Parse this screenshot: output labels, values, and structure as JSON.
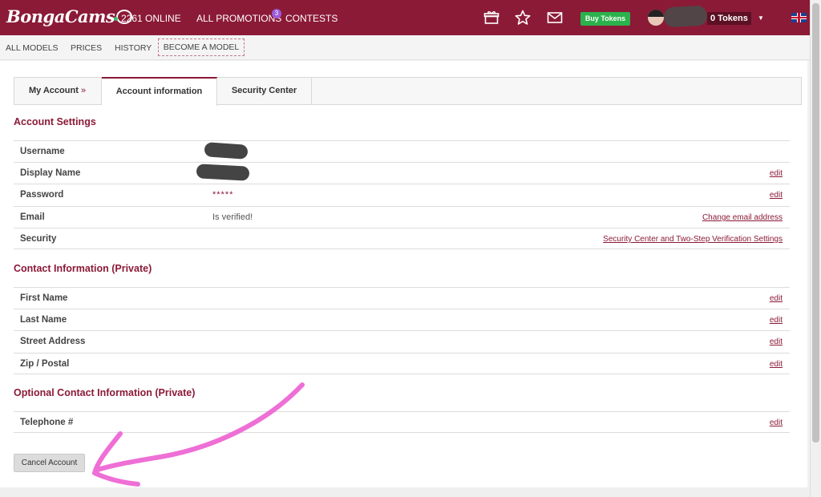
{
  "header": {
    "logo_text": "BongaCams",
    "online_text": "2261 ONLINE",
    "promotions_label": "ALL PROMOTIONS",
    "promotions_badge": "3",
    "contests_label": "CONTESTS",
    "buy_tokens_label": "Buy Tokens",
    "tokens_label": "0 Tokens",
    "icons": [
      "gift-icon",
      "star-icon",
      "mail-icon",
      "chevron-down-icon",
      "uk-flag-icon"
    ]
  },
  "subnav": {
    "items": [
      "ALL MODELS",
      "PRICES",
      "HISTORY"
    ],
    "become_model": "BECOME A MODEL"
  },
  "tabs": {
    "my_account": "My Account",
    "my_account_suffix": "»",
    "account_information": "Account information",
    "security_center": "Security Center"
  },
  "account_settings": {
    "title": "Account Settings",
    "rows": [
      {
        "label": "Username",
        "value": "",
        "action": ""
      },
      {
        "label": "Display Name",
        "value": "",
        "action": "edit"
      },
      {
        "label": "Password",
        "value": "*****",
        "action": "edit"
      },
      {
        "label": "Email",
        "value": "Is verified!",
        "action": "Change email address"
      },
      {
        "label": "Security",
        "value": "",
        "action": "Security Center and Two-Step Verification Settings"
      }
    ]
  },
  "contact_info": {
    "title": "Contact Information (Private)",
    "rows": [
      {
        "label": "First Name",
        "action": "edit"
      },
      {
        "label": "Last Name",
        "action": "edit"
      },
      {
        "label": "Street Address",
        "action": "edit"
      },
      {
        "label": "Zip / Postal",
        "action": "edit"
      }
    ]
  },
  "optional_contact": {
    "title": "Optional Contact Information (Private)",
    "rows": [
      {
        "label": "Telephone #",
        "action": "edit"
      }
    ]
  },
  "cancel_account_label": "Cancel Account",
  "colors": {
    "brand": "#8b1a37",
    "buy_button": "#2bb24c",
    "annotation": "#ee6fd6"
  }
}
